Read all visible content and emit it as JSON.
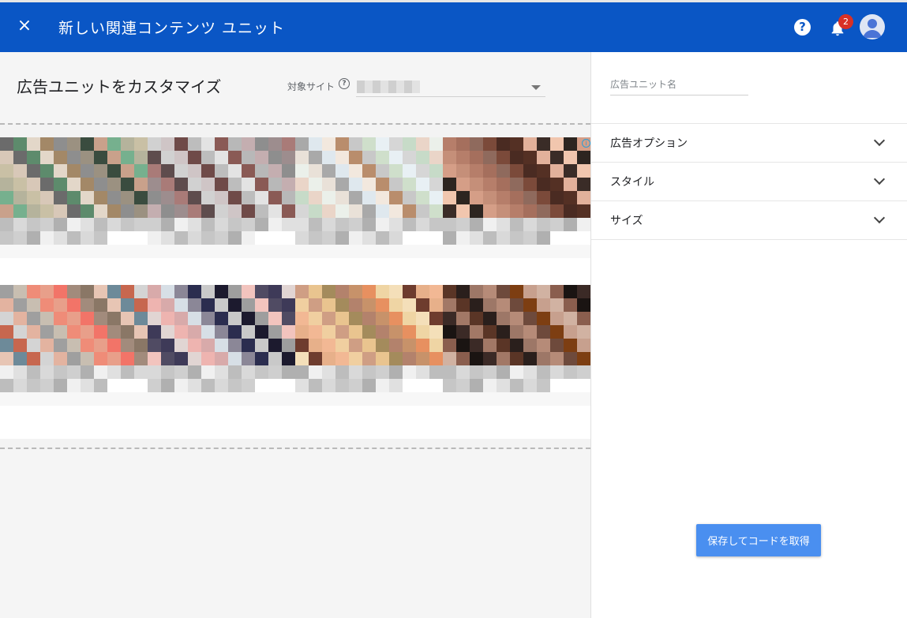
{
  "header": {
    "title": "新しい関連コンテンツ ユニット",
    "close_icon": "×",
    "help_icon": "?",
    "notification_count": "2",
    "colors": {
      "bar": "#0a56c5",
      "badge": "#d93025"
    }
  },
  "customize": {
    "title": "広告ユニットをカスタマイズ",
    "site_label": "対象サイト",
    "help_icon": "?"
  },
  "preview": {
    "ad_info_icon": "i",
    "tiles": [
      {
        "palette": [
          "#6b6b6b",
          "#c9a18b",
          "#e3d7c9",
          "#b5b39c",
          "#8e8e8e",
          "#d8c8b8",
          "#3a4c3f",
          "#5d8b6c",
          "#76b08e",
          "#a38867",
          "#c9c0a5",
          "#9b9181"
        ]
      },
      {
        "palette": [
          "#bdbdbd",
          "#a97b78",
          "#8a5a55",
          "#d1d1d1",
          "#c4aeb0",
          "#6f4a48",
          "#9d8d8e",
          "#e3e3e3",
          "#5e4c4d",
          "#b8b8b8",
          "#cfc5c6",
          "#8e8e8e"
        ]
      },
      {
        "palette": [
          "#e8f0f4",
          "#dfe8ee",
          "#c7dbc8",
          "#b98d6c",
          "#ebf0ea",
          "#cfdfcb",
          "#a9a9a9",
          "#d6d6d6",
          "#f2e8de",
          "#ead5c8",
          "#c8c8c8",
          "#e9e1d8"
        ]
      },
      {
        "palette": [
          "#2d2520",
          "#4a2b22",
          "#c58f79",
          "#e2b19b",
          "#a56f5d",
          "#f1c6ae",
          "#7b4a3a",
          "#d59e87",
          "#543024",
          "#b67e6a",
          "#3a2c27",
          "#8f6a5d"
        ]
      },
      {
        "palette": [
          "#9f9f9f",
          "#e7c5b4",
          "#ef8c78",
          "#c7674f",
          "#f27468",
          "#e3b3a0",
          "#8a7766",
          "#c8beb1",
          "#6d8a99",
          "#e89f8a",
          "#d4d4d4",
          "#a28b7c"
        ]
      },
      {
        "palette": [
          "#2b2d4f",
          "#e1d5d3",
          "#1c1a2e",
          "#d8aaaa",
          "#f2c4be",
          "#8b8797",
          "#3e3a58",
          "#c9c9c9",
          "#eeb4b0",
          "#9e9e9e",
          "#d7dfe6",
          "#504b63"
        ]
      },
      {
        "palette": [
          "#efd5a4",
          "#e9c48f",
          "#6e3c2e",
          "#b3826c",
          "#f2b894",
          "#e79060",
          "#cf9e84",
          "#f4dfb9",
          "#a48b5c",
          "#e7b08a",
          "#c7926a",
          "#f0cfa0"
        ]
      },
      {
        "palette": [
          "#1a1412",
          "#6e4a3c",
          "#a27866",
          "#c7a08e",
          "#2a1f1c",
          "#8a5e4e",
          "#b68b78",
          "#3b2a26",
          "#7d3e12",
          "#5a3526",
          "#d1b2a2",
          "#9d7767"
        ]
      }
    ]
  },
  "right_panel": {
    "unit_name_placeholder": "広告ユニット名",
    "sections": [
      {
        "label": "広告オプション"
      },
      {
        "label": "スタイル"
      },
      {
        "label": "サイズ"
      }
    ],
    "save_button": "保存してコードを取得",
    "accent": "#4a8ff0"
  }
}
